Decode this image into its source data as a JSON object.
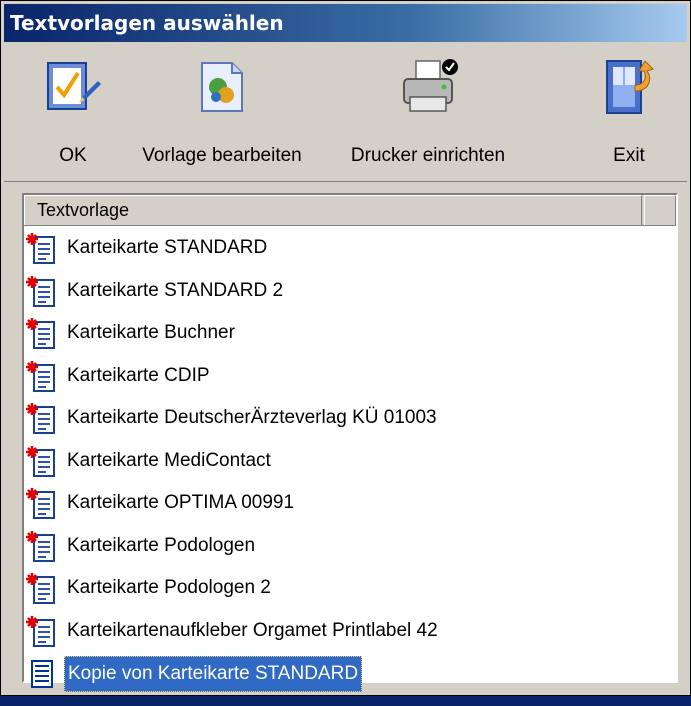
{
  "window": {
    "title": "Textvorlagen auswählen"
  },
  "toolbar": {
    "ok": {
      "label": "OK",
      "icon": "checklist-pencil-icon"
    },
    "vorlage": {
      "label": "Vorlage bearbeiten",
      "icon": "document-edit-icon"
    },
    "drucker": {
      "label": "Drucker einrichten",
      "icon": "printer-check-icon"
    },
    "exit": {
      "label": "Exit",
      "icon": "door-exit-icon"
    }
  },
  "list": {
    "column_header": "Textvorlage",
    "items": [
      {
        "label": "Karteikarte STANDARD",
        "icon": "template-doc-icon",
        "selected": false
      },
      {
        "label": "Karteikarte STANDARD 2",
        "icon": "template-doc-icon",
        "selected": false
      },
      {
        "label": "Karteikarte Buchner",
        "icon": "template-doc-icon",
        "selected": false
      },
      {
        "label": "Karteikarte CDIP",
        "icon": "template-doc-icon",
        "selected": false
      },
      {
        "label": "Karteikarte DeutscherÄrzteverlag KÜ 01003",
        "icon": "template-doc-icon",
        "selected": false
      },
      {
        "label": "Karteikarte MediContact",
        "icon": "template-doc-icon",
        "selected": false
      },
      {
        "label": "Karteikarte OPTIMA 00991",
        "icon": "template-doc-icon",
        "selected": false
      },
      {
        "label": "Karteikarte Podologen",
        "icon": "template-doc-icon",
        "selected": false
      },
      {
        "label": "Karteikarte Podologen 2",
        "icon": "template-doc-icon",
        "selected": false
      },
      {
        "label": "Karteikartenaufkleber Orgamet Printlabel 42",
        "icon": "template-doc-icon",
        "selected": false
      },
      {
        "label": "Kopie von Karteikarte STANDARD",
        "icon": "blank-doc-icon",
        "selected": true
      }
    ]
  },
  "colors": {
    "title_bar": "#0a246a",
    "selection": "#316ac5",
    "face": "#d4d0c8"
  }
}
